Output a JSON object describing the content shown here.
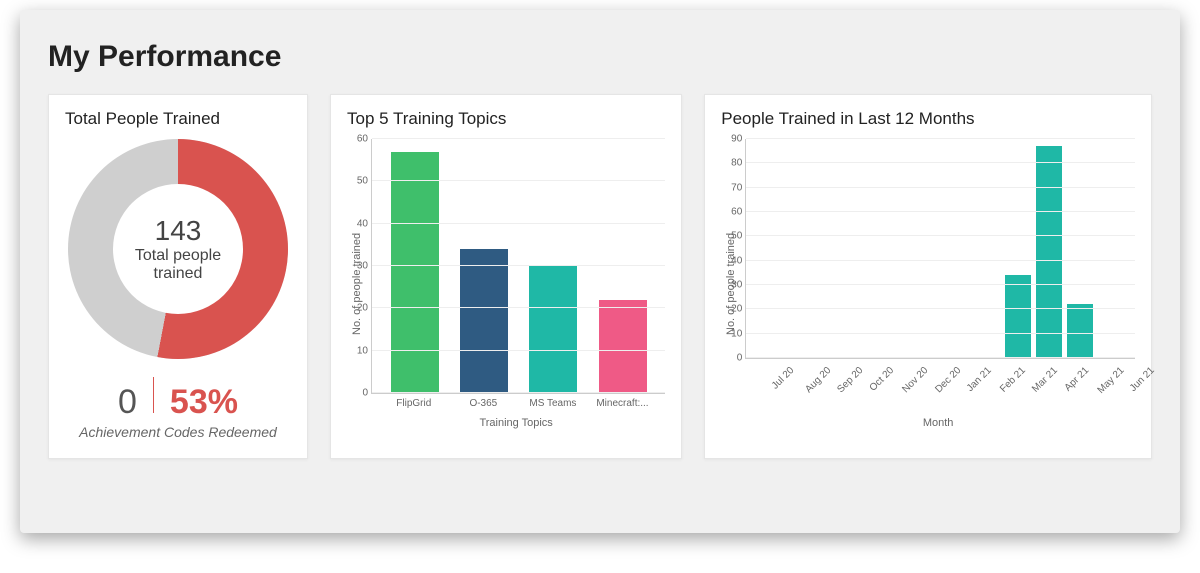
{
  "title": "My Performance",
  "donut_card": {
    "title": "Total People Trained",
    "value": 143,
    "label": "Total people trained",
    "redeemed_count": 0,
    "percent": "53%",
    "sub": "Achievement Codes Redeemed",
    "percent_value": 53,
    "ring_color": "#d9534f",
    "ring_bg": "#cfcfcf"
  },
  "topics_card": {
    "title": "Top 5 Training Topics",
    "ylabel": "No. of people trained",
    "xlabel": "Training Topics"
  },
  "monthly_card": {
    "title": "People Trained in Last 12 Months",
    "ylabel": "No. of people trained",
    "xlabel": "Month"
  },
  "chart_data": [
    {
      "type": "bar",
      "title": "Top 5 Training Topics",
      "xlabel": "Training Topics",
      "ylabel": "No. of people trained",
      "ylim": [
        0,
        60
      ],
      "yticks": [
        0,
        10,
        20,
        30,
        40,
        50,
        60
      ],
      "categories": [
        "FlipGrid",
        "O-365",
        "MS Teams",
        "Minecraft:..."
      ],
      "values": [
        57,
        34,
        30,
        22
      ],
      "colors": [
        "#3fbf6b",
        "#2f5b82",
        "#1fb8a6",
        "#ef5a86"
      ]
    },
    {
      "type": "bar",
      "title": "People Trained in Last 12 Months",
      "xlabel": "Month",
      "ylabel": "No. of people trained",
      "ylim": [
        0,
        90
      ],
      "yticks": [
        0,
        10,
        20,
        30,
        40,
        50,
        60,
        70,
        80,
        90
      ],
      "categories": [
        "Jul 20",
        "Aug 20",
        "Sep 20",
        "Oct 20",
        "Nov 20",
        "Dec 20",
        "Jan 21",
        "Feb 21",
        "Mar 21",
        "Apr 21",
        "May 21",
        "Jun 21"
      ],
      "values": [
        0,
        0,
        0,
        0,
        0,
        0,
        0,
        0,
        34,
        87,
        22,
        0
      ],
      "color": "#1fb8a6"
    }
  ]
}
